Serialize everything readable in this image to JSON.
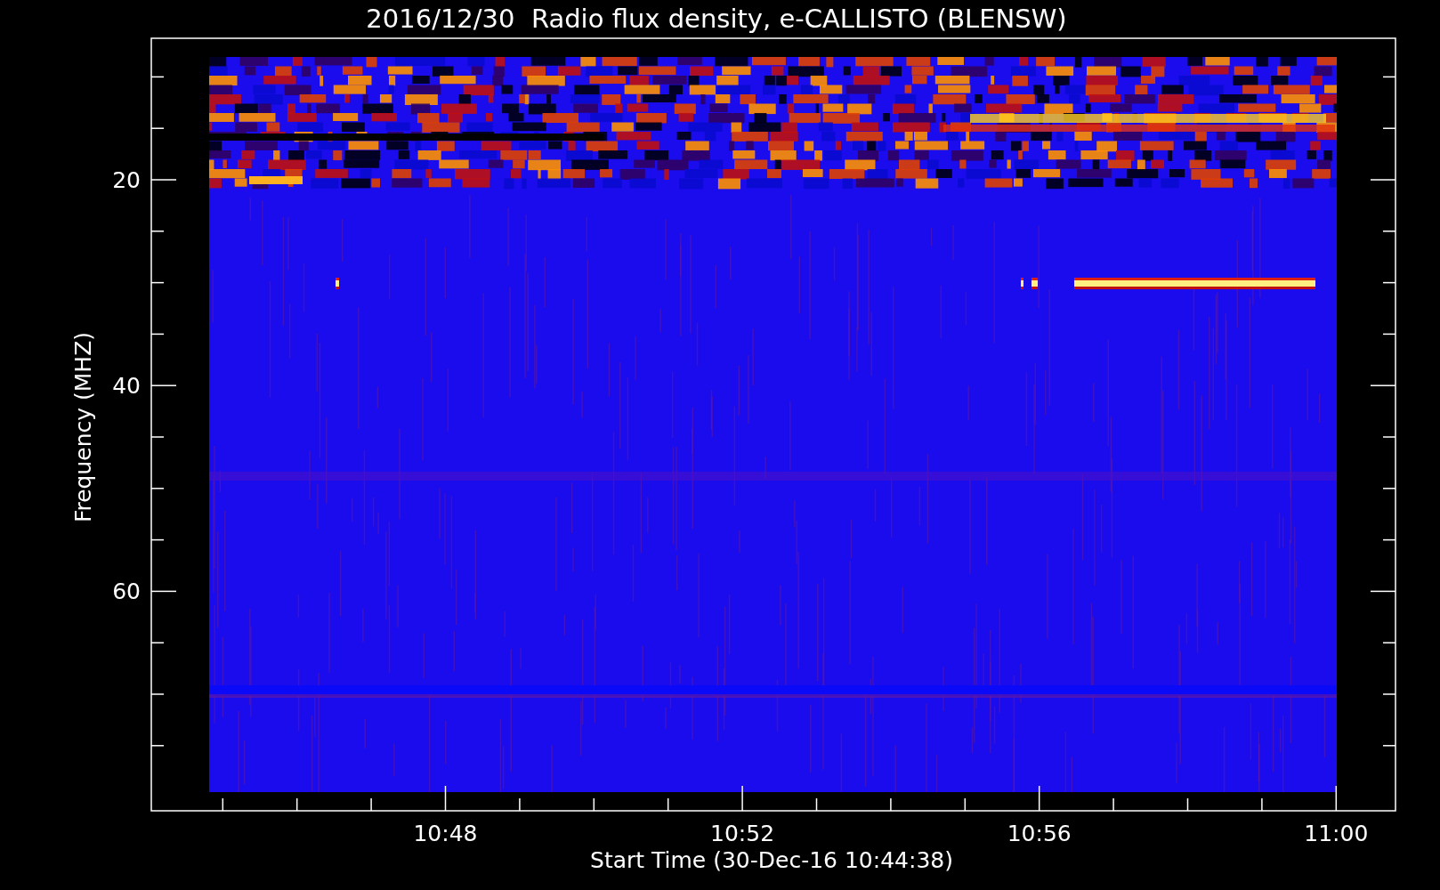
{
  "title": "2016/12/30  Radio flux density, e-CALLISTO (BLENSW)",
  "y_axis": {
    "label": "Frequency (MHZ)",
    "ticks": [
      "20",
      "40",
      "60"
    ]
  },
  "x_axis": {
    "label": "Start Time (30-Dec-16 10:44:38)",
    "ticks": [
      "10:48",
      "10:52",
      "10:56",
      "11:00"
    ]
  }
}
